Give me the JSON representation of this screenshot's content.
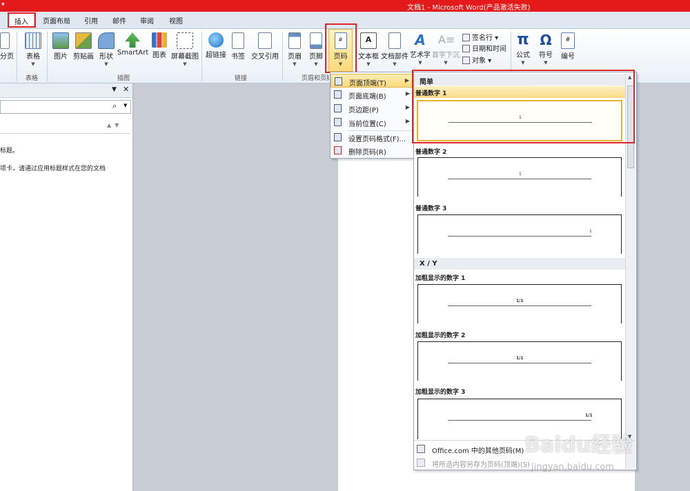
{
  "window": {
    "title": "文档1 - Microsoft Word(产品激活失败)"
  },
  "tabs": [
    {
      "label": "插入",
      "active": true
    },
    {
      "label": "页面布局"
    },
    {
      "label": "引用"
    },
    {
      "label": "邮件"
    },
    {
      "label": "审阅"
    },
    {
      "label": "视图"
    }
  ],
  "ribbon": {
    "buttons": [
      {
        "label": "分页",
        "icon": "page-break-icon"
      },
      {
        "label": "表格",
        "icon": "table-icon",
        "dropdown": true
      },
      {
        "label": "图片",
        "icon": "picture-icon"
      },
      {
        "label": "剪贴画",
        "icon": "clipart-icon"
      },
      {
        "label": "形状",
        "icon": "shapes-icon",
        "dropdown": true
      },
      {
        "label": "SmartArt",
        "icon": "smartart-icon"
      },
      {
        "label": "图表",
        "icon": "chart-icon"
      },
      {
        "label": "屏幕截图",
        "icon": "screenshot-icon",
        "dropdown": true
      },
      {
        "label": "超链接",
        "icon": "hyperlink-icon"
      },
      {
        "label": "书签",
        "icon": "bookmark-icon"
      },
      {
        "label": "交叉引用",
        "icon": "cross-reference-icon"
      },
      {
        "label": "页眉",
        "icon": "header-icon",
        "dropdown": true
      },
      {
        "label": "页脚",
        "icon": "footer-icon",
        "dropdown": true
      },
      {
        "label": "页码",
        "icon": "page-number-icon",
        "dropdown": true,
        "active": true
      },
      {
        "label": "文本框",
        "icon": "textbox-icon",
        "dropdown": true
      },
      {
        "label": "文档部件",
        "icon": "quick-parts-icon",
        "dropdown": true
      },
      {
        "label": "艺术字",
        "icon": "wordart-icon",
        "dropdown": true
      },
      {
        "label": "首字下沉",
        "icon": "drop-cap-icon",
        "dropdown": true,
        "disabled": true
      },
      {
        "label": "公式",
        "icon": "equation-icon",
        "dropdown": true
      },
      {
        "label": "符号",
        "icon": "symbol-icon",
        "dropdown": true
      },
      {
        "label": "编号",
        "icon": "number-icon"
      }
    ],
    "small_items": [
      {
        "label": "签名行 ▾",
        "icon": "signature-line-icon"
      },
      {
        "label": "日期和时间",
        "icon": "date-time-icon"
      },
      {
        "label": "对象 ▾",
        "icon": "object-icon"
      }
    ],
    "groups": [
      "表格",
      "插图",
      "链接",
      "页眉和页脚"
    ]
  },
  "navpane": {
    "text1": "标题。",
    "text2": "项卡，请通过应用标题样式在您的文档"
  },
  "submenu": {
    "items": [
      {
        "label": "页面顶端(T)",
        "submenu": true,
        "highlighted": true
      },
      {
        "label": "页面底端(B)",
        "submenu": true
      },
      {
        "label": "页边距(P)",
        "submenu": true
      },
      {
        "label": "当前位置(C)",
        "submenu": true
      },
      {
        "label": "设置页码格式(F)...",
        "submenu": false
      },
      {
        "label": "删除页码(R)",
        "submenu": false
      }
    ]
  },
  "gallery": {
    "sections": [
      {
        "header": "简单",
        "items": [
          {
            "label": "普通数字 1",
            "sample": "1",
            "align": "center",
            "selected": true
          },
          {
            "label": "普通数字 2",
            "sample": "1",
            "align": "center"
          },
          {
            "label": "普通数字 3",
            "sample": "1",
            "align": "right"
          }
        ]
      },
      {
        "header": "X / Y",
        "items": [
          {
            "label": "加粗显示的数字 1",
            "sample": "1/1",
            "align": "center"
          },
          {
            "label": "加粗显示的数字 2",
            "sample": "1/1",
            "align": "center"
          },
          {
            "label": "加粗显示的数字 3",
            "sample": "1/1",
            "align": "right"
          }
        ]
      }
    ],
    "footer": [
      {
        "label": "Office.com 中的其他页码(M)",
        "enabled": true
      },
      {
        "label": "将所选内容另存为页码(顶端)(S)",
        "enabled": false
      }
    ]
  },
  "watermark": {
    "brand": "Baidu经验",
    "url": "jingyan.baidu.com"
  },
  "colors": {
    "title_bar": "#e41a1a",
    "highlight_box": "#e0262d",
    "hover": "#fbd77a"
  }
}
